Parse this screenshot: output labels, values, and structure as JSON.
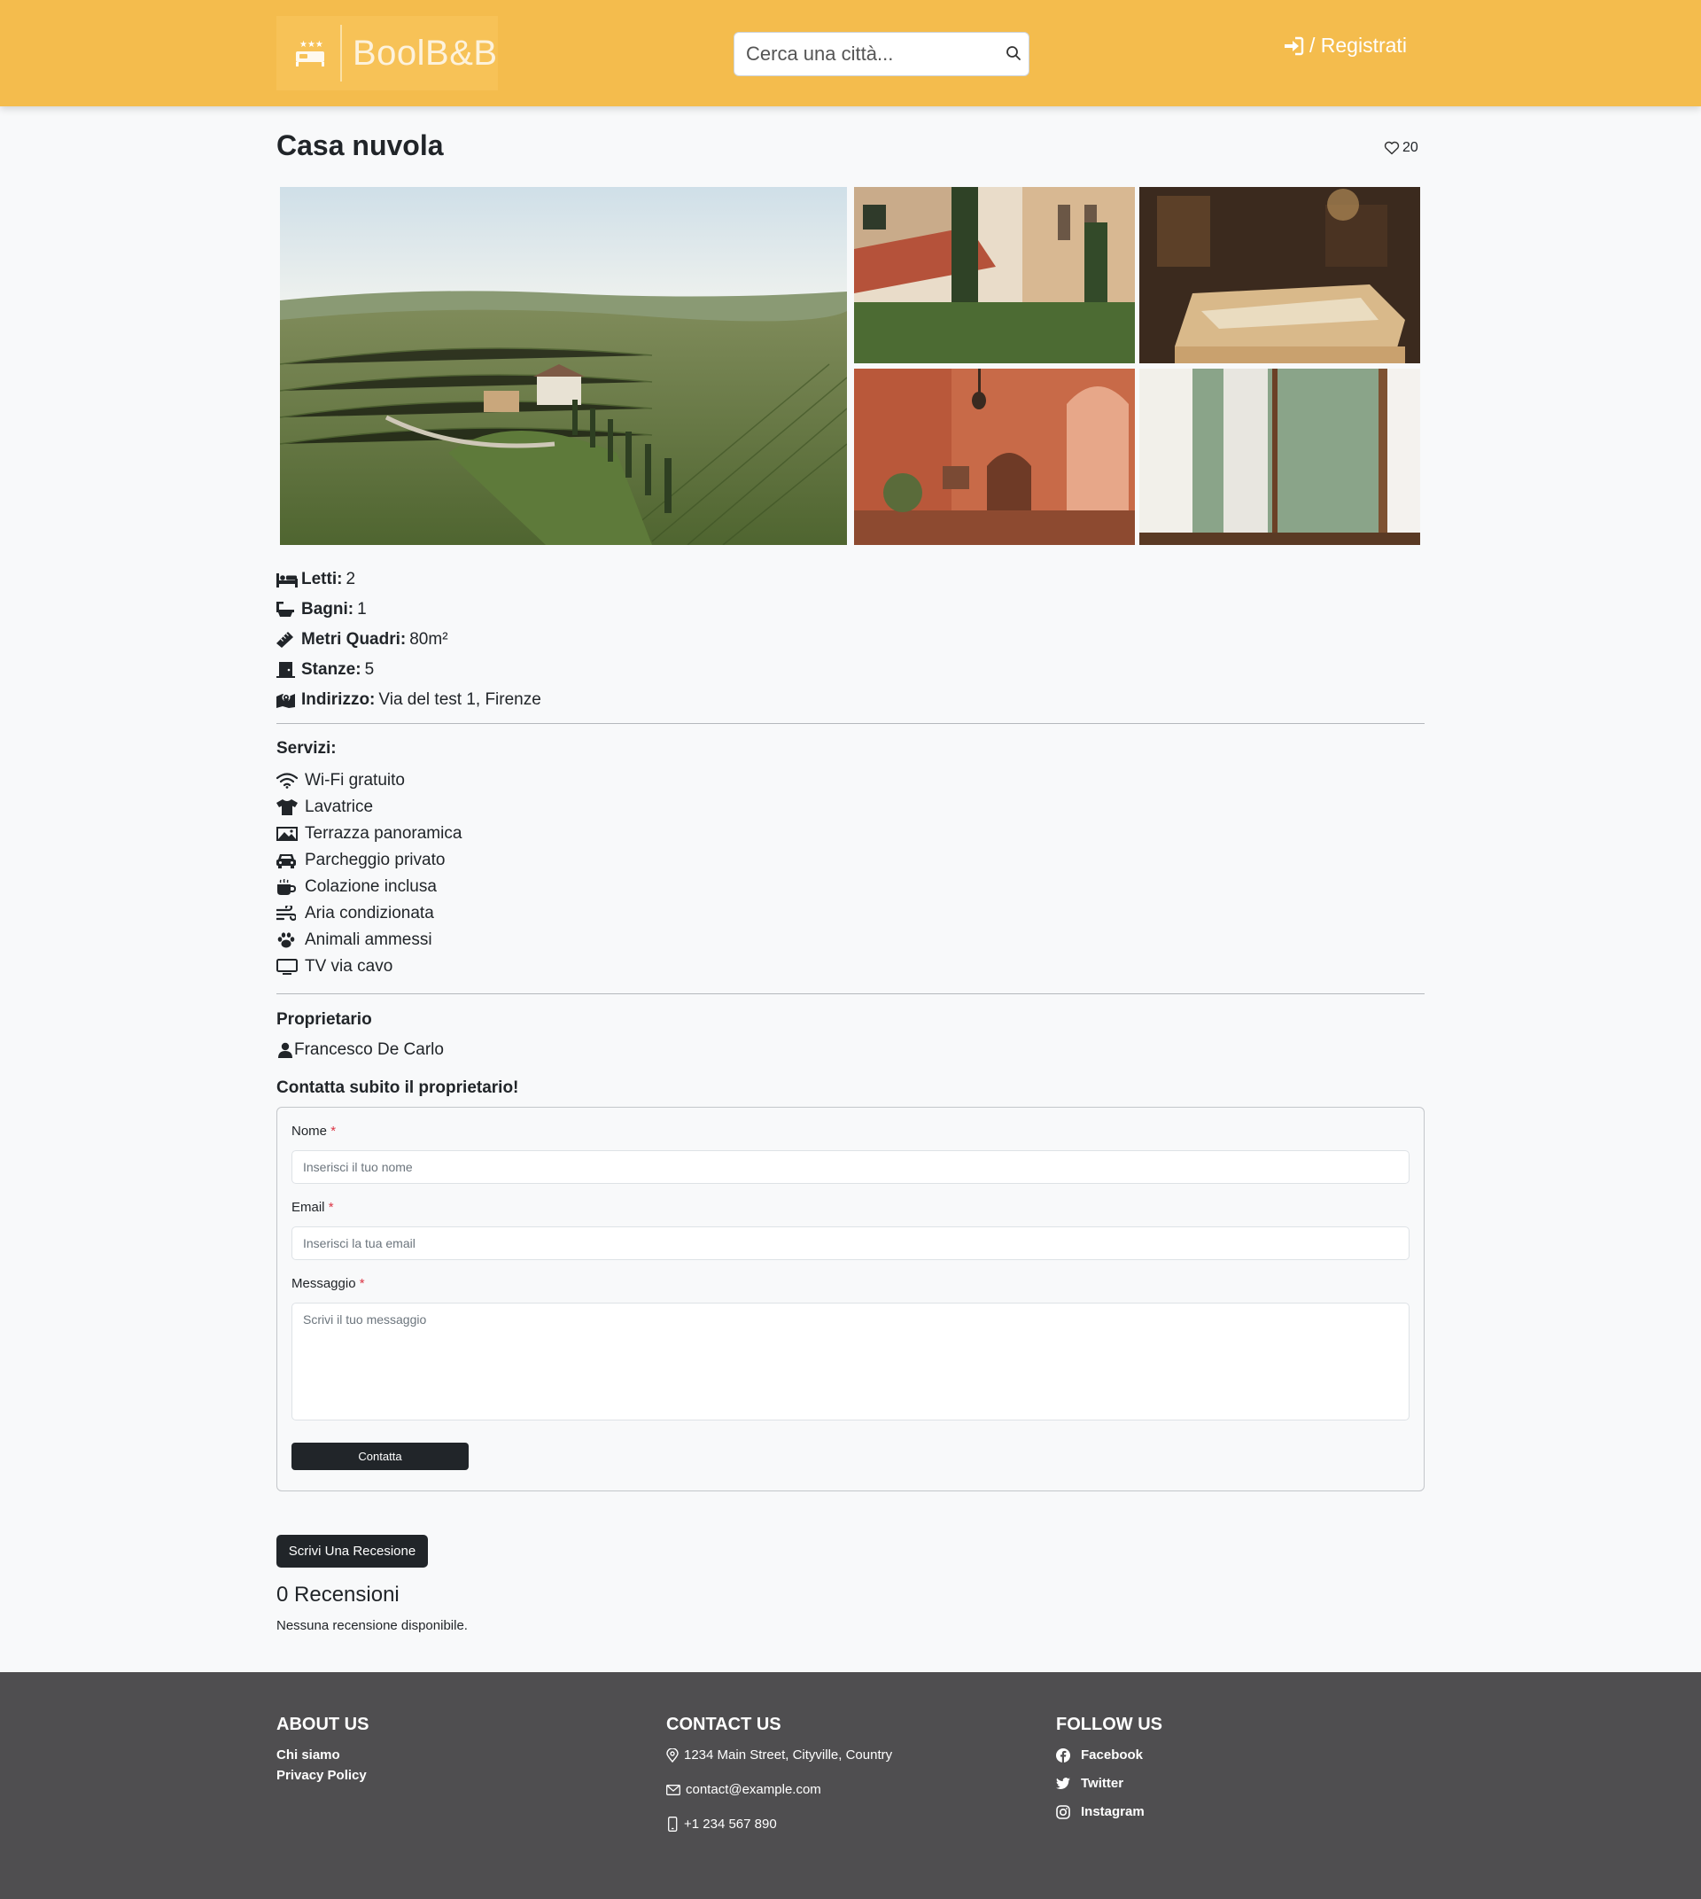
{
  "header": {
    "brand": "BoolB&B",
    "search_placeholder": "Cerca una città...",
    "login_label": "/ Registrati",
    "bg_color": "#f4bc4d"
  },
  "property": {
    "title": "Casa nuvola",
    "likes": "20",
    "details": [
      {
        "icon": "bed-icon",
        "label": "Letti:",
        "value": "2"
      },
      {
        "icon": "bath-icon",
        "label": "Bagni:",
        "value": "1"
      },
      {
        "icon": "ruler-icon",
        "label": "Metri Quadri:",
        "value": "80m²"
      },
      {
        "icon": "door-icon",
        "label": "Stanze:",
        "value": "5"
      },
      {
        "icon": "map-icon",
        "label": "Indirizzo:",
        "value": "Via del test 1, Firenze"
      }
    ]
  },
  "services": {
    "title": "Servizi:",
    "items": [
      {
        "icon": "wifi-icon",
        "label": "Wi-Fi gratuito"
      },
      {
        "icon": "shirt-icon",
        "label": "Lavatrice"
      },
      {
        "icon": "panorama-icon",
        "label": "Terrazza panoramica"
      },
      {
        "icon": "car-icon",
        "label": "Parcheggio privato"
      },
      {
        "icon": "coffee-icon",
        "label": "Colazione inclusa"
      },
      {
        "icon": "wind-icon",
        "label": "Aria condizionata"
      },
      {
        "icon": "paw-icon",
        "label": "Animali ammessi"
      },
      {
        "icon": "tv-icon",
        "label": "TV via cavo"
      }
    ]
  },
  "owner": {
    "title": "Proprietario",
    "name": "Francesco De Carlo",
    "contact_title": "Contatta subito il proprietario!"
  },
  "form": {
    "name_label": "Nome",
    "name_placeholder": "Inserisci il tuo nome",
    "email_label": "Email",
    "email_placeholder": "Inserisci la tua email",
    "message_label": "Messaggio",
    "message_placeholder": "Scrivi il tuo messaggio",
    "required_mark": "*",
    "submit_label": "Contatta"
  },
  "reviews": {
    "write_label": "Scrivi Una Recesione",
    "count_title": "0 Recensioni",
    "empty_text": "Nessuna recensione disponibile."
  },
  "footer": {
    "about_title": "ABOUT US",
    "about_links": [
      "Chi siamo",
      "Privacy Policy"
    ],
    "contact_title": "CONTACT US",
    "address": "1234 Main Street, Cityville, Country",
    "email": "contact@example.com",
    "phone": "+1 234 567 890",
    "follow_title": "FOLLOW US",
    "social": [
      "Facebook",
      "Twitter",
      "Instagram"
    ],
    "bg_color": "#4f4e50"
  }
}
